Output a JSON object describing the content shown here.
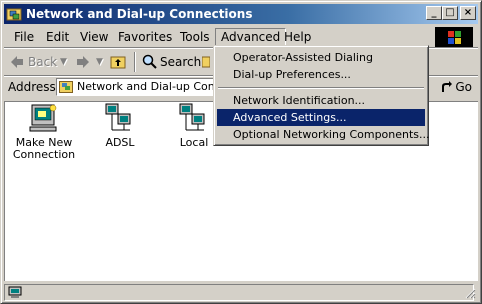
{
  "window": {
    "title": "Network and Dial-up Connections"
  },
  "title_buttons": {
    "minimize": "_",
    "maximize": "□",
    "close": "×"
  },
  "menubar": {
    "items": [
      "File",
      "Edit",
      "View",
      "Favorites",
      "Tools",
      "Advanced",
      "Help"
    ],
    "active": "Advanced"
  },
  "toolbar": {
    "back": "Back",
    "search": "Search"
  },
  "address": {
    "label": "Address",
    "value": "Network and Dial-up Connec",
    "go": "Go"
  },
  "items": [
    {
      "label_1": "Make New",
      "label_2": "Connection",
      "icon": "make-new-connection-icon"
    },
    {
      "label_1": "ADSL",
      "label_2": "",
      "icon": "network-connection-icon"
    },
    {
      "label_1": "Local",
      "label_2": "",
      "icon": "network-connection-icon"
    }
  ],
  "advanced_menu": {
    "items": [
      {
        "label": "Operator-Assisted Dialing",
        "highlighted": false
      },
      {
        "label": "Dial-up Preferences...",
        "highlighted": false
      },
      {
        "label": "Network Identification...",
        "highlighted": false
      },
      {
        "label": "Advanced Settings...",
        "highlighted": true
      },
      {
        "label": "Optional Networking Components...",
        "highlighted": false
      }
    ]
  },
  "colors": {
    "titlebar": "#0a246a",
    "highlight": "#0a246a",
    "face": "#d4d0c8"
  }
}
